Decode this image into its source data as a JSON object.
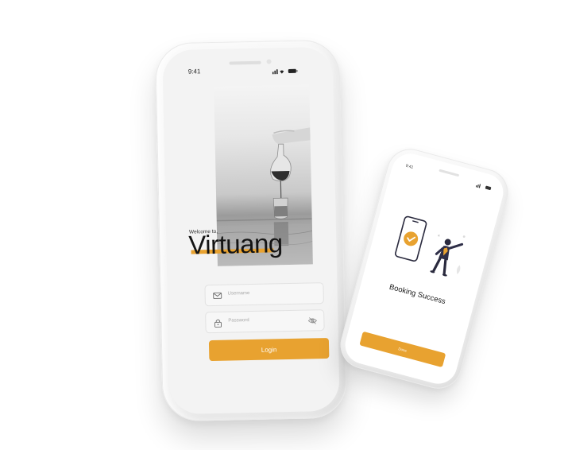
{
  "login_phone": {
    "status_time": "9:41",
    "welcome_text": "Welcome to,",
    "brand": "Virtuang",
    "username_placeholder": "Username",
    "password_placeholder": "Password",
    "login_label": "Login"
  },
  "booking_phone": {
    "status_time": "9:41",
    "title": "Booking Success",
    "done_label": "Done"
  },
  "colors": {
    "accent": "#e8a230",
    "device": "#f2f2f2",
    "text": "#141414"
  }
}
